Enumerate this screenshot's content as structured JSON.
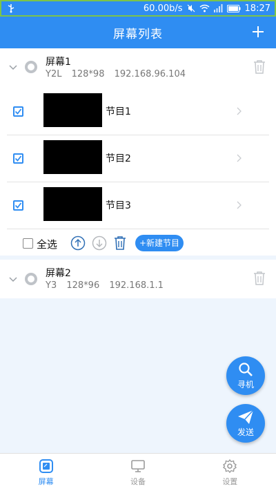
{
  "status_bar": {
    "speed": "60.00b/s",
    "time": "18:27"
  },
  "header": {
    "title": "屏幕列表"
  },
  "screens": [
    {
      "name": "屏幕1",
      "model": "Y2L",
      "resolution": "128*98",
      "ip": "192.168.96.104",
      "programs": [
        {
          "name": "节目1"
        },
        {
          "name": "节目2"
        },
        {
          "name": "节目3"
        }
      ]
    },
    {
      "name": "屏幕2",
      "model": "Y3",
      "resolution": "128*96",
      "ip": "192.168.1.1"
    }
  ],
  "toolbar": {
    "select_all": "全选",
    "new_program": "+新建节目"
  },
  "fabs": {
    "search": "寻机",
    "send": "发送"
  },
  "bottom_nav": [
    {
      "label": "屏幕"
    },
    {
      "label": "设备"
    },
    {
      "label": "设置"
    }
  ],
  "colors": {
    "accent": "#2f8df2",
    "status_border": "#7cc44a"
  }
}
